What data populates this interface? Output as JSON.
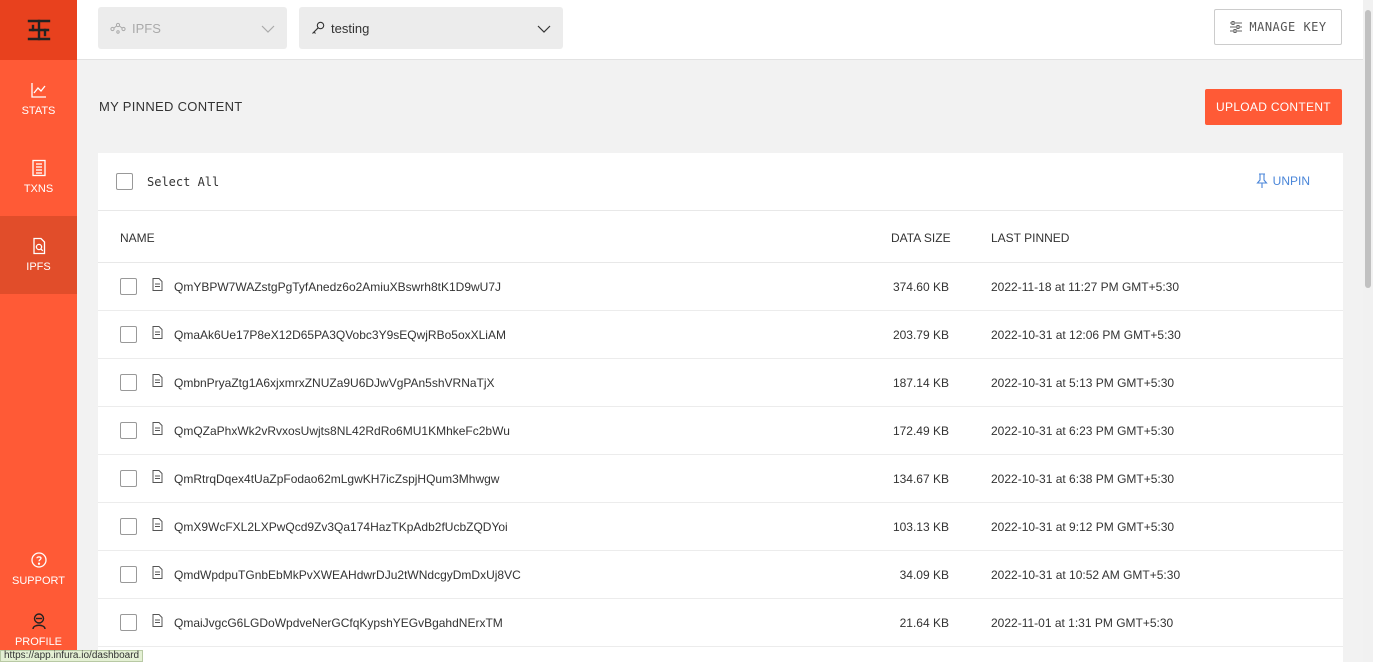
{
  "sidebar": {
    "items": [
      {
        "label": "STATS",
        "icon": "chart-line-icon"
      },
      {
        "label": "TXNS",
        "icon": "receipt-icon"
      },
      {
        "label": "IPFS",
        "icon": "file-search-icon",
        "active": true
      }
    ],
    "support_label": "SUPPORT",
    "profile_label": "PROFILE",
    "brand_color": "#ff5a36"
  },
  "topbar": {
    "network_placeholder": "IPFS",
    "project_value": "testing",
    "manage_key_label": "MANAGE KEY"
  },
  "main": {
    "title": "MY PINNED CONTENT",
    "upload_label": "UPLOAD CONTENT",
    "select_all_label": "Select All",
    "unpin_label": "UNPIN",
    "columns": {
      "name": "NAME",
      "size": "DATA SIZE",
      "date": "LAST PINNED"
    },
    "rows": [
      {
        "name": "QmYBPW7WAZstgPgTyfAnedz6o2AmiuXBswrh8tK1D9wU7J",
        "size": "374.60 KB",
        "date": "2022-11-18 at 11:27 PM GMT+5:30"
      },
      {
        "name": "QmaAk6Ue17P8eX12D65PA3QVobc3Y9sEQwjRBo5oxXLiAM",
        "size": "203.79 KB",
        "date": "2022-10-31 at 12:06 PM GMT+5:30"
      },
      {
        "name": "QmbnPryaZtg1A6xjxmrxZNUZa9U6DJwVgPAn5shVRNaTjX",
        "size": "187.14 KB",
        "date": "2022-10-31 at 5:13 PM GMT+5:30"
      },
      {
        "name": "QmQZaPhxWk2vRvxosUwjts8NL42RdRo6MU1KMhkeFc2bWu",
        "size": "172.49 KB",
        "date": "2022-10-31 at 6:23 PM GMT+5:30"
      },
      {
        "name": "QmRtrqDqex4tUaZpFodao62mLgwKH7icZspjHQum3Mhwgw",
        "size": "134.67 KB",
        "date": "2022-10-31 at 6:38 PM GMT+5:30"
      },
      {
        "name": "QmX9WcFXL2LXPwQcd9Zv3Qa174HazTKpAdb2fUcbZQDYoi",
        "size": "103.13 KB",
        "date": "2022-10-31 at 9:12 PM GMT+5:30"
      },
      {
        "name": "QmdWpdpuTGnbEbMkPvXWEAHdwrDJu2tWNdcgyDmDxUj8VC",
        "size": "34.09 KB",
        "date": "2022-10-31 at 10:52 AM GMT+5:30"
      },
      {
        "name": "QmaiJvgcG6LGDoWpdveNerGCfqKypshYEGvBgahdNErxTM",
        "size": "21.64 KB",
        "date": "2022-11-01 at 1:31 PM GMT+5:30"
      }
    ]
  },
  "status_bar": {
    "url": "https://app.infura.io/dashboard"
  }
}
